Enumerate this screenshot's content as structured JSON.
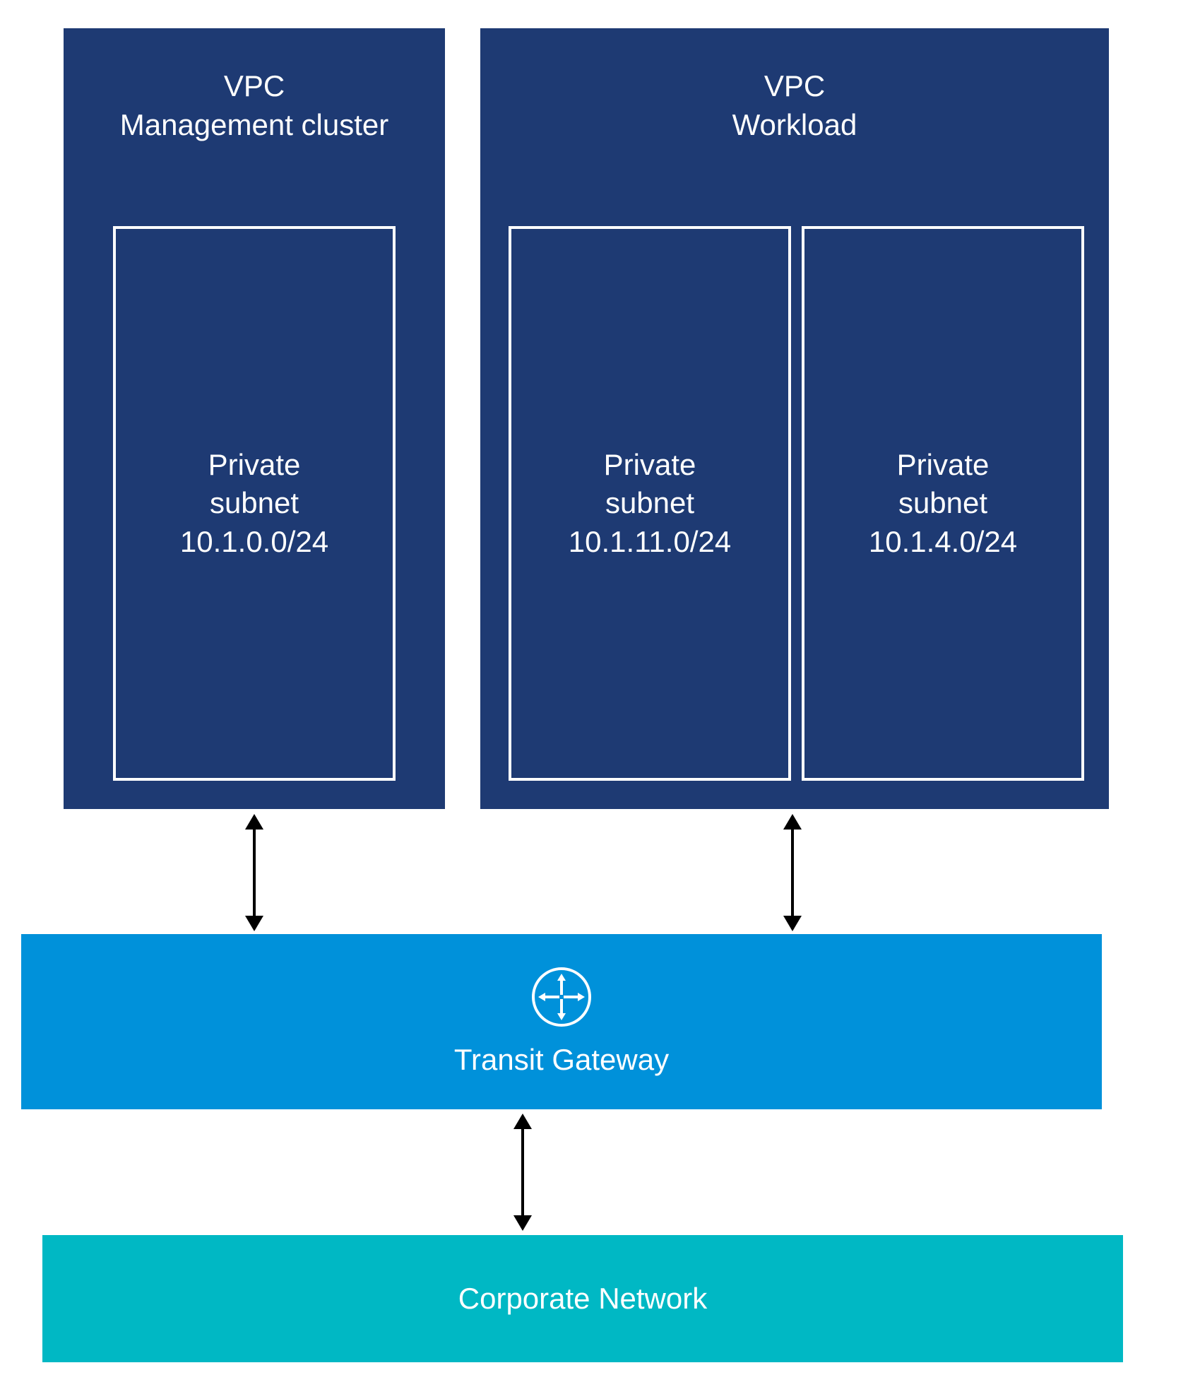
{
  "vpc_mgmt": {
    "title_line1": "VPC",
    "title_line2": "Management cluster",
    "subnets": [
      {
        "label": "Private",
        "type": "subnet",
        "cidr": "10.1.0.0/24"
      }
    ]
  },
  "vpc_workload": {
    "title_line1": "VPC",
    "title_line2": "Workload",
    "subnets": [
      {
        "label": "Private",
        "type": "subnet",
        "cidr": "10.1.11.0/24"
      },
      {
        "label": "Private",
        "type": "subnet",
        "cidr": "10.1.4.0/24"
      }
    ]
  },
  "transit_gateway": {
    "label": "Transit Gateway"
  },
  "corporate_network": {
    "label": "Corporate Network"
  },
  "colors": {
    "vpc_bg": "#1e3a73",
    "tg_bg": "#0091da",
    "corp_bg": "#00b8c4"
  }
}
